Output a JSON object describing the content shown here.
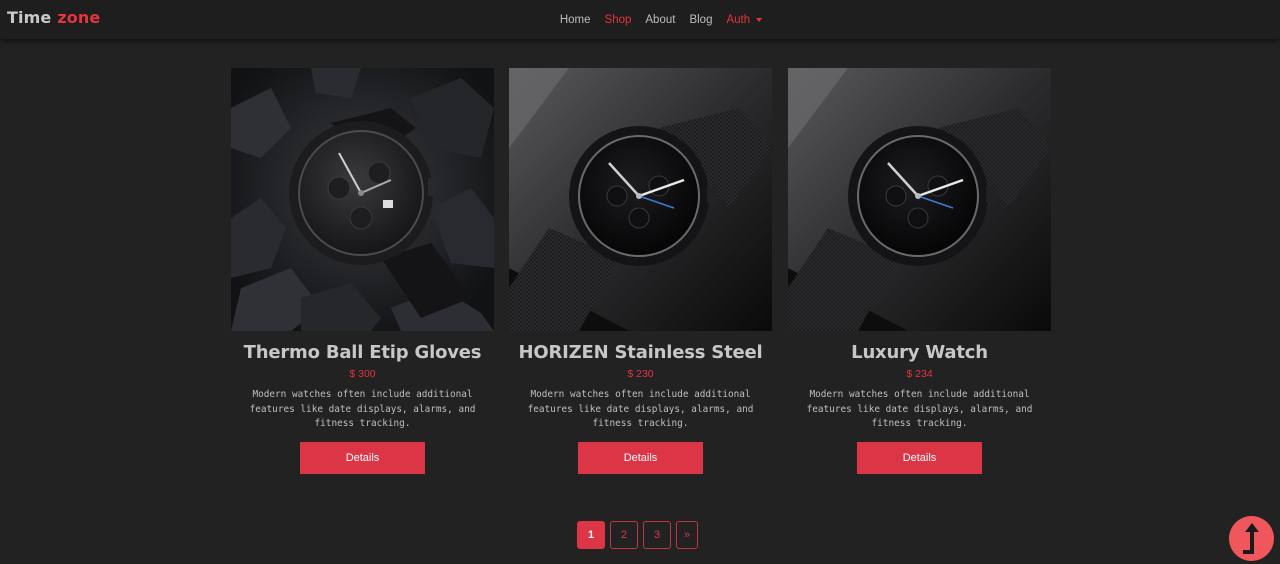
{
  "brand": {
    "part1": "Time",
    "part2": "zone"
  },
  "nav": {
    "home": "Home",
    "shop": "Shop",
    "about": "About",
    "blog": "Blog",
    "auth": "Auth"
  },
  "products": [
    {
      "title": "Thermo Ball Etip Gloves",
      "price": "$ 300",
      "description": "Modern watches often include additional features like date displays, alarms, and fitness tracking.",
      "button": "Details"
    },
    {
      "title": "HORIZEN Stainless Steel",
      "price": "$ 230",
      "description": "Modern watches often include additional features like date displays, alarms, and fitness tracking.",
      "button": "Details"
    },
    {
      "title": "Luxury Watch",
      "price": "$ 234",
      "description": "Modern watches often include additional features like date displays, alarms, and fitness tracking.",
      "button": "Details"
    }
  ],
  "pagination": {
    "pages": [
      "1",
      "2",
      "3"
    ],
    "next": "»",
    "current": "1"
  },
  "colors": {
    "accent": "#dc3545",
    "background": "#222222",
    "navbar": "#1e1e1e"
  },
  "icons": {
    "scroll_top": "arrow-up-icon",
    "auth_dropdown": "caret-down-icon"
  }
}
